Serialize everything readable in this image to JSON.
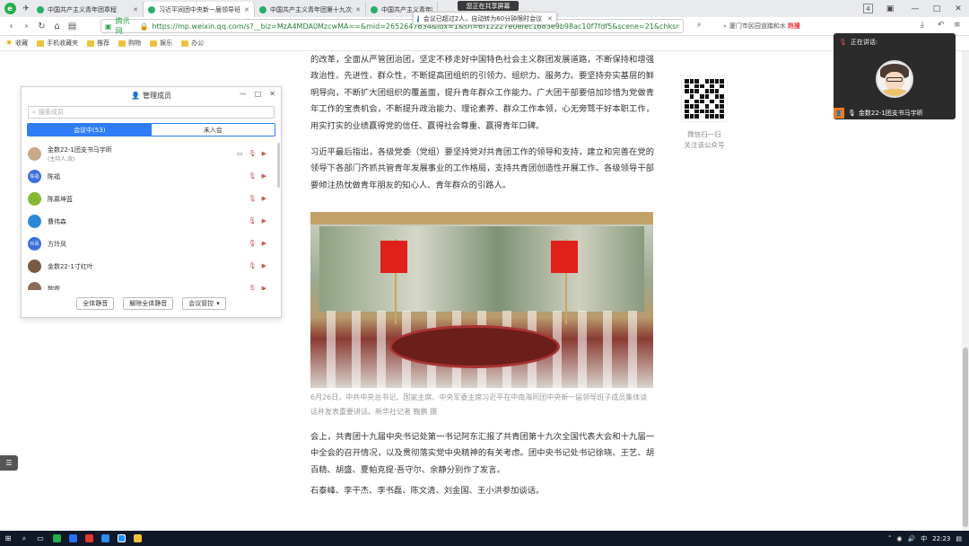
{
  "browser": {
    "tabs": [
      {
        "label": "中国共产主义青年团章程"
      },
      {
        "label": "习近平同团中央新一届领导班"
      },
      {
        "label": "中国共产主义青年团第十九次全"
      },
      {
        "label": "中国共产主义青年团"
      }
    ],
    "active_tab": 1,
    "tab_count": "4",
    "address": {
      "secure_label": "腾讯网",
      "url": "https://mp.weixin.qq.com/s?__biz=MzA4MDA0MzcwMA==&mid=2652647634&idx=1&sn=6f12227e0efec1683e9b98ac10f7fdf5&scene=21&chksm=8442db09b335521"
    },
    "search_text": "厦门市民园道踏和水",
    "search_hot": "热搜",
    "bookmarks": [
      "收藏",
      "手机收藏夹",
      "推荐",
      "购物",
      "娱乐",
      "办公"
    ]
  },
  "meeting": {
    "sharing_pill": "您正在共享屏幕",
    "notice": "会议已超过2人，自动转为60分钟限时会议",
    "panel": {
      "title": "管理成员",
      "search_placeholder": "搜索成员",
      "tab_in": "会议中(53)",
      "tab_out": "未入会",
      "members": [
        {
          "name": "金数22-1团支书马宇昕",
          "sub": "(主持人,我)",
          "avatar_color": "#c9a98a",
          "avatar_text": ""
        },
        {
          "name": "陈福",
          "sub": "",
          "avatar_color": "#3b6fd9",
          "avatar_text": "陈福"
        },
        {
          "name": "陈慕坤蓝",
          "sub": "",
          "avatar_color": "#86b833",
          "avatar_text": ""
        },
        {
          "name": "曹伟森",
          "sub": "",
          "avatar_color": "#2b88d8",
          "avatar_text": ""
        },
        {
          "name": "方玲凤",
          "sub": "",
          "avatar_color": "#3b6fd9",
          "avatar_text": "玲凤"
        },
        {
          "name": "金数22-1寸红叶",
          "sub": "",
          "avatar_color": "#7a5a45",
          "avatar_text": ""
        },
        {
          "name": "黎霞",
          "sub": "",
          "avatar_color": "#8a6c5a",
          "avatar_text": ""
        }
      ],
      "mute_all": "全体静音",
      "unmute_all": "解除全体静音",
      "meeting_control": "会议管控"
    },
    "speaker": {
      "label": "正在讲话:",
      "name": "金数22-1团支书马宇昕"
    }
  },
  "article": {
    "p1": "的改革，全面从严管团治团，坚定不移走好中国特色社会主义群团发展道路，不断保持和增强政治性、先进性、群众性，不断提高团组织的引领力、组织力、服务力。要坚持夯实基层的鲜明导向，不断扩大团组织的覆盖面，提升青年群众工作能力。广大团干部要倍加珍惜为党做青年工作的宝贵机会，不断提升政治能力、理论素养、群众工作本领，心无旁骛干好本职工作，用实打实的业绩赢得党的信任、赢得社会尊重、赢得青年口碑。",
    "p2": "习近平最后指出，各级党委（党组）要坚持党对共青团工作的领导和支持，建立和完善在党的领导下各部门齐抓共管青年发展事业的工作格局，支持共青团创造性开展工作。各级领导干部要倾注热忱做青年朋友的知心人、青年群众的引路人。",
    "caption": "6月26日，中共中央总书记、国家主席、中央军委主席习近平在中南海同团中央新一届领导班子成员集体谈话并发表重要讲话。新华社记者 鞠鹏 摄",
    "p3": "会上，共青团十九届中央书记处第一书记阿东汇报了共青团第十九次全国代表大会和十九届一中全会的召开情况，以及贯彻落实党中央精神的有关考虑。团中央书记处书记徐晓、王艺、胡百精、胡盛、夏帕克提·吾守尔、余静分别作了发言。",
    "p4": "石泰峰、李干杰、李书磊、陈文清、刘金国、王小洪参加谈话。",
    "qr_caption_1": "微信扫一扫",
    "qr_caption_2": "关注该公众号"
  },
  "taskbar": {
    "time": "22:23",
    "ime": "中"
  }
}
